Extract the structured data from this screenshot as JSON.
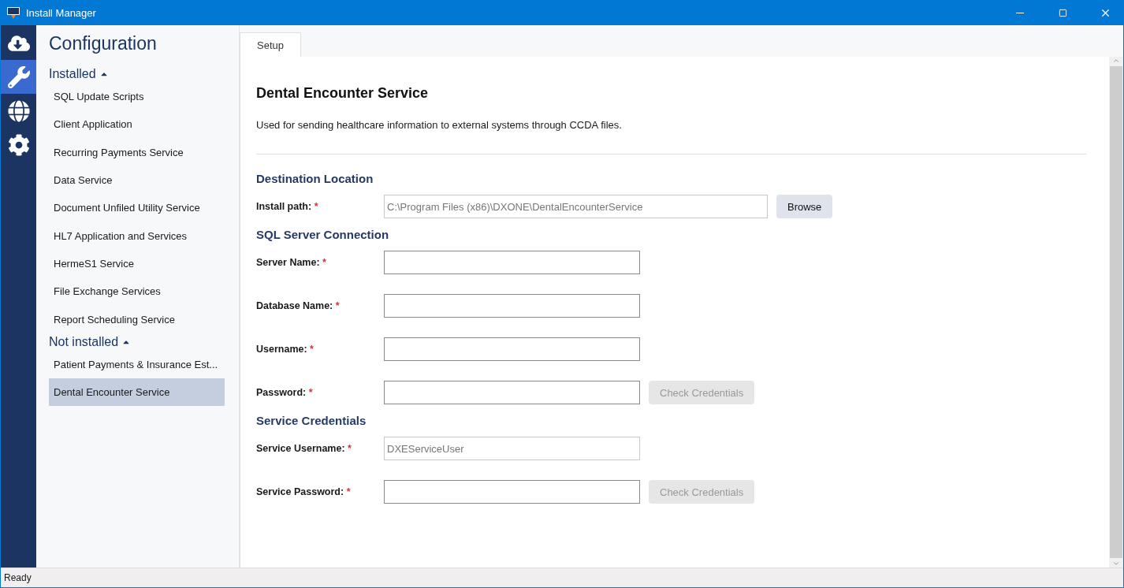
{
  "window": {
    "title": "Install Manager"
  },
  "nav_rail": [
    {
      "selected": false
    },
    {
      "selected": true
    },
    {
      "selected": false
    },
    {
      "selected": false
    }
  ],
  "sidebar": {
    "title": "Configuration",
    "groups": [
      {
        "label": "Installed",
        "expanded": true,
        "items": [
          {
            "label": "SQL Update Scripts",
            "selected": false
          },
          {
            "label": "Client Application",
            "selected": false
          },
          {
            "label": "Recurring Payments Service",
            "selected": false
          },
          {
            "label": "Data Service",
            "selected": false
          },
          {
            "label": "Document Unfiled Utility Service",
            "selected": false
          },
          {
            "label": "HL7 Application and Services",
            "selected": false
          },
          {
            "label": "HermeS1 Service",
            "selected": false
          },
          {
            "label": "File Exchange Services",
            "selected": false
          },
          {
            "label": "Report Scheduling Service",
            "selected": false
          }
        ]
      },
      {
        "label": "Not installed",
        "expanded": true,
        "items": [
          {
            "label": "Patient Payments & Insurance Est...",
            "selected": false
          },
          {
            "label": "Dental Encounter Service",
            "selected": true
          }
        ]
      }
    ]
  },
  "tabs": [
    {
      "label": "Setup",
      "selected": true
    }
  ],
  "service": {
    "title": "Dental Encounter Service",
    "description": "Used for sending healthcare information to external systems through CCDA files."
  },
  "sections": [
    {
      "title": "Destination Location",
      "fields": [
        {
          "kind": "path",
          "label": "Install path:",
          "required_mark": "*",
          "value": "C:\\Program Files (x86)\\DXONE\\DentalEncounterService",
          "button": {
            "label": "Browse",
            "disabled": false
          }
        }
      ]
    },
    {
      "title": "SQL Server Connection",
      "fields": [
        {
          "kind": "text",
          "label": "Server Name:",
          "required_mark": "*"
        },
        {
          "kind": "text",
          "label": "Database Name:",
          "required_mark": "*"
        },
        {
          "kind": "text",
          "label": "Username:",
          "required_mark": "*"
        },
        {
          "kind": "text",
          "label": "Password:",
          "required_mark": "*",
          "button": {
            "label": "Check Credentials",
            "disabled": true
          }
        }
      ]
    },
    {
      "title": "Service Credentials",
      "fields": [
        {
          "kind": "text",
          "label": "Service Username:",
          "required_mark": "*",
          "value": "DXEServiceUser"
        },
        {
          "kind": "text",
          "label": "Service Password:",
          "required_mark": "*",
          "button": {
            "label": "Check Credentials",
            "disabled": true
          }
        }
      ]
    }
  ],
  "status_bar": {
    "text": "Ready"
  }
}
